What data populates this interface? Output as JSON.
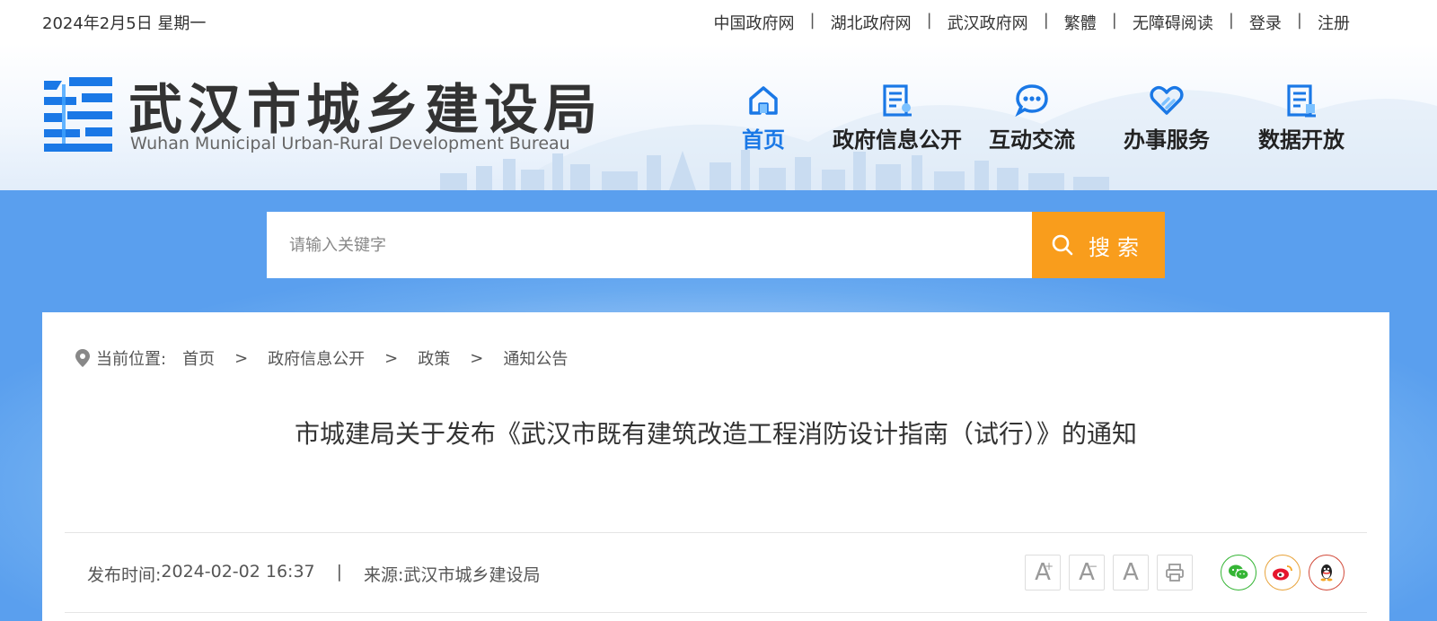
{
  "topbar": {
    "date": "2024年2月5日 星期一",
    "links": [
      "中国政府网",
      "湖北政府网",
      "武汉政府网",
      "繁體",
      "无障碍阅读",
      "登录",
      "注册"
    ]
  },
  "header": {
    "logo_cn": "武汉市城乡建设局",
    "logo_en": "Wuhan Municipal Urban-Rural Development Bureau",
    "nav": [
      {
        "label": "首页",
        "icon": "home-icon",
        "active": true
      },
      {
        "label": "政府信息公开",
        "icon": "document-icon"
      },
      {
        "label": "互动交流",
        "icon": "chat-icon"
      },
      {
        "label": "办事服务",
        "icon": "heart-hand-icon"
      },
      {
        "label": "数据开放",
        "icon": "data-doc-icon"
      }
    ]
  },
  "search": {
    "placeholder": "请输入关键字",
    "button": "搜索"
  },
  "breadcrumb": {
    "label": "当前位置:",
    "items": [
      "首页",
      "政府信息公开",
      "政策",
      "通知公告"
    ]
  },
  "article": {
    "title": "市城建局关于发布《武汉市既有建筑改造工程消防设计指南（试行）》的通知",
    "publish_label": "发布时间:",
    "publish_time": "2024-02-02 16:37",
    "source_label": "来源:",
    "source": "武汉市城乡建设局"
  },
  "tools": {
    "font_large": "A",
    "font_small": "A",
    "font_default": "A"
  },
  "colors": {
    "accent_blue": "#1a78e6",
    "search_orange": "#f99d1c"
  }
}
